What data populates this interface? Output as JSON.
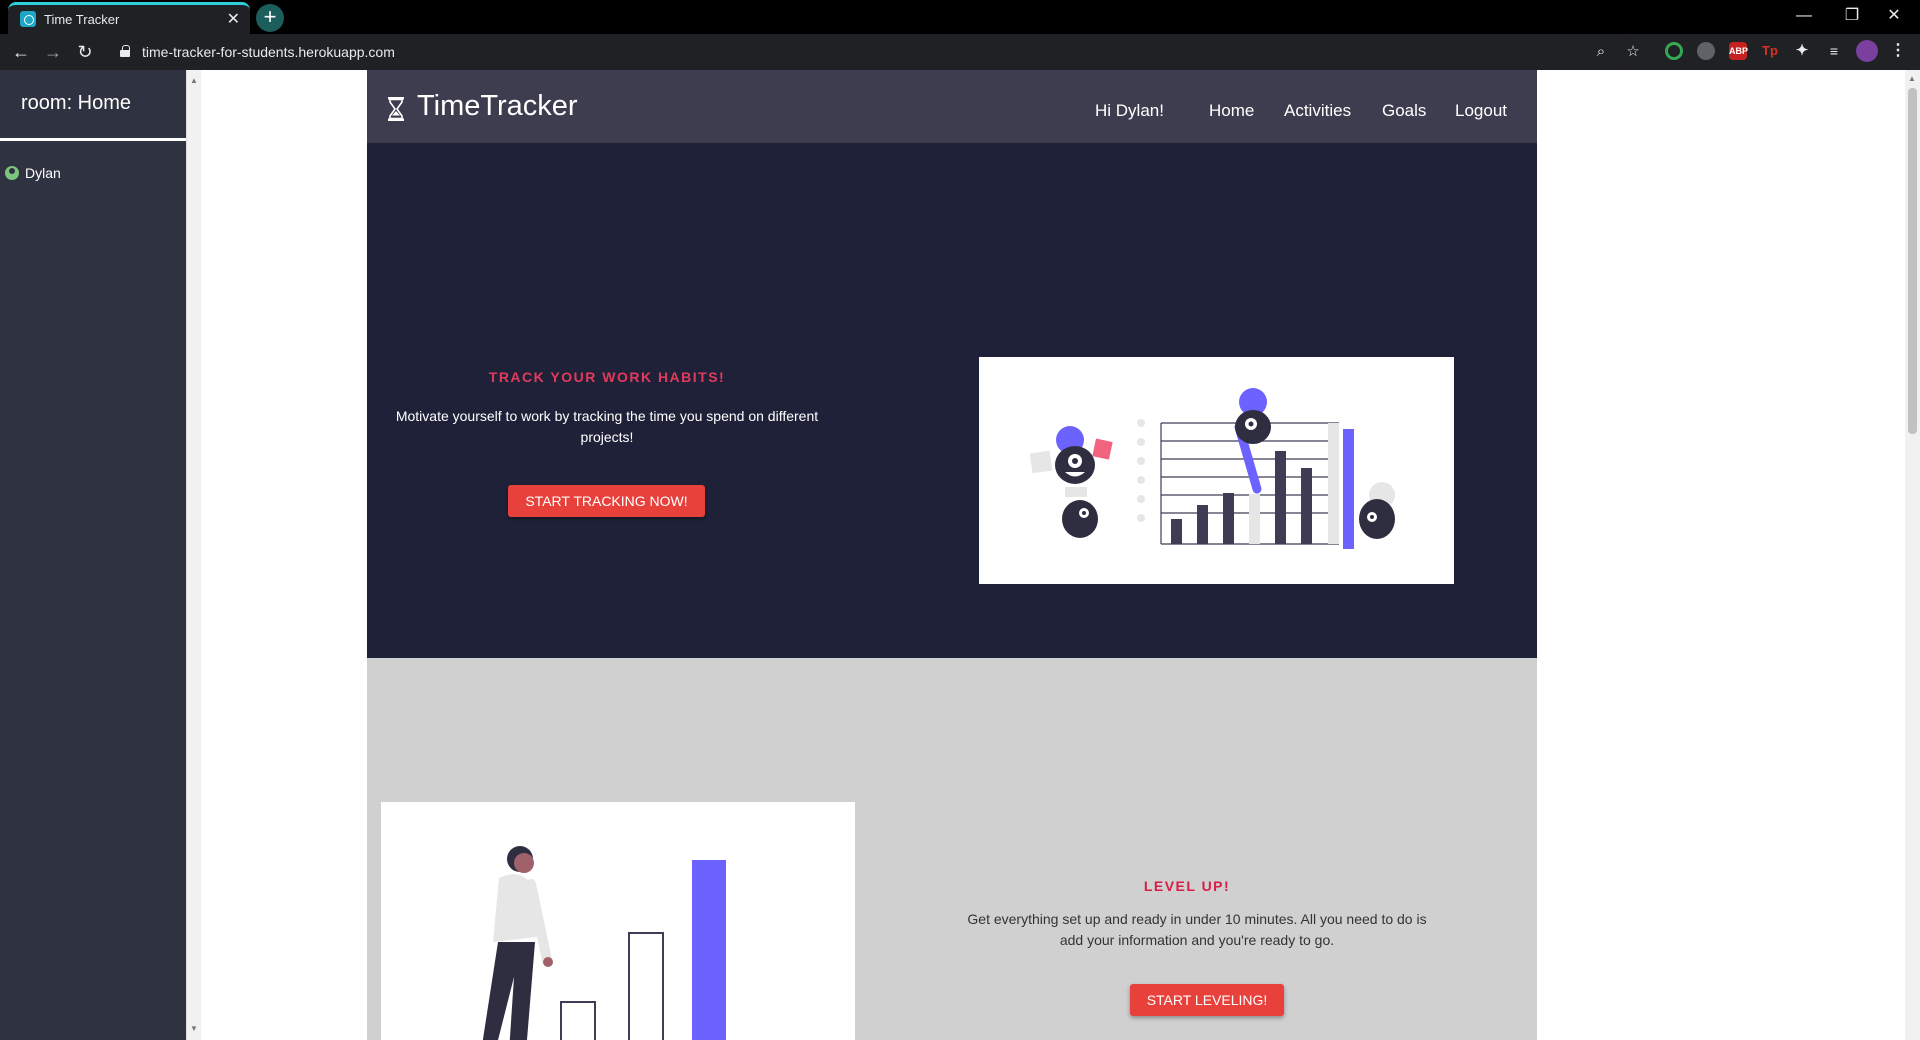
{
  "browser": {
    "tab_title": "Time Tracker",
    "tab_close": "✕",
    "new_tab": "+",
    "url": "time-tracker-for-students.herokuapp.com",
    "window_controls": {
      "minimize": "—",
      "restore": "❐",
      "close": "✕"
    },
    "nav": {
      "back": "←",
      "forward": "→",
      "reload": "↻"
    },
    "omnibox_icons": {
      "zoom": "⌕",
      "bookmark": "☆"
    },
    "extensions": [
      {
        "name": "ring-extension-icon",
        "color": "#34a853",
        "label": ""
      },
      {
        "name": "owl-extension-icon",
        "color": "#5f6368",
        "label": ""
      },
      {
        "name": "adblock-extension-icon",
        "color": "#c5221f",
        "label": "ABP"
      },
      {
        "name": "tp-extension-icon",
        "color": "#d93025",
        "label": "Tp"
      }
    ]
  },
  "sidebar": {
    "room_title": "room: Home",
    "users": [
      {
        "name": "Dylan",
        "status_color": "#7bc67b"
      }
    ]
  },
  "navbar": {
    "brand": "TimeTracker",
    "greeting": "Hi Dylan!",
    "links": [
      "Home",
      "Activities",
      "Goals",
      "Logout"
    ]
  },
  "hero": {
    "heading": "TRACK YOUR WORK HABITS!",
    "text": "Motivate yourself to work by tracking the time you spend on different projects!",
    "button": "START TRACKING NOW!"
  },
  "section2": {
    "heading": "LEVEL UP!",
    "text": "Get everything set up and ready in under 10 minutes. All you need to do is add your information and you're ready to go.",
    "button": "START LEVELING!"
  },
  "colors": {
    "navbar": "#3e3d4f",
    "hero_bg": "#1f2138",
    "accent_red": "#e8413c",
    "heading_pink": "#e23a5d",
    "illustration_purple": "#6c63ff"
  }
}
